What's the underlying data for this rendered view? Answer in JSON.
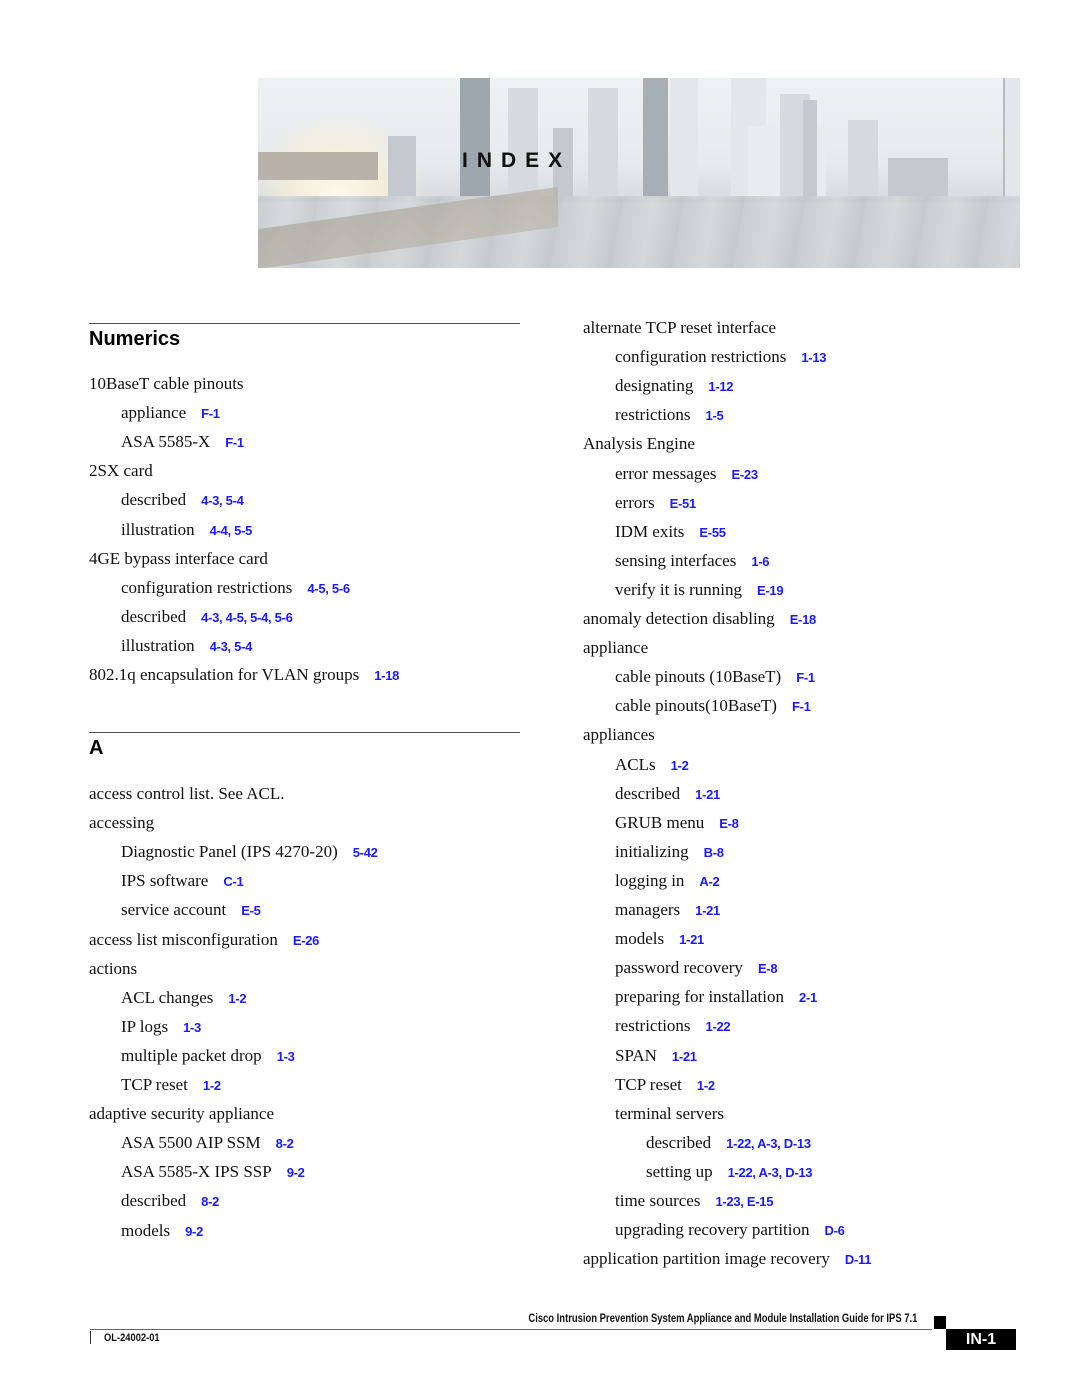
{
  "banner": {
    "title": "INDEX"
  },
  "columns": [
    {
      "sections": [
        {
          "heading": "Numerics",
          "entries": [
            {
              "level": 0,
              "text": "10BaseT cable pinouts",
              "refs": ""
            },
            {
              "level": 1,
              "text": "appliance",
              "refs": "F-1"
            },
            {
              "level": 1,
              "text": "ASA 5585-X",
              "refs": "F-1"
            },
            {
              "level": 0,
              "text": "2SX card",
              "refs": ""
            },
            {
              "level": 1,
              "text": "described",
              "refs": "4-3, 5-4"
            },
            {
              "level": 1,
              "text": "illustration",
              "refs": "4-4, 5-5"
            },
            {
              "level": 0,
              "text": "4GE bypass interface card",
              "refs": ""
            },
            {
              "level": 1,
              "text": "configuration restrictions",
              "refs": "4-5, 5-6"
            },
            {
              "level": 1,
              "text": "described",
              "refs": "4-3, 4-5, 5-4, 5-6"
            },
            {
              "level": 1,
              "text": "illustration",
              "refs": "4-3, 5-4"
            },
            {
              "level": 0,
              "text": "802.1q encapsulation for VLAN groups",
              "refs": "1-18"
            }
          ]
        },
        {
          "heading": "A",
          "entries": [
            {
              "level": 0,
              "text": "access control list. See ACL.",
              "refs": ""
            },
            {
              "level": 0,
              "text": "accessing",
              "refs": ""
            },
            {
              "level": 1,
              "text": "Diagnostic Panel (IPS 4270-20)",
              "refs": "5-42"
            },
            {
              "level": 1,
              "text": "IPS software",
              "refs": "C-1"
            },
            {
              "level": 1,
              "text": "service account",
              "refs": "E-5"
            },
            {
              "level": 0,
              "text": "access list misconfiguration",
              "refs": "E-26"
            },
            {
              "level": 0,
              "text": "actions",
              "refs": ""
            },
            {
              "level": 1,
              "text": "ACL changes",
              "refs": "1-2"
            },
            {
              "level": 1,
              "text": "IP logs",
              "refs": "1-3"
            },
            {
              "level": 1,
              "text": "multiple packet drop",
              "refs": "1-3"
            },
            {
              "level": 1,
              "text": "TCP reset",
              "refs": "1-2"
            },
            {
              "level": 0,
              "text": "adaptive security appliance",
              "refs": ""
            },
            {
              "level": 1,
              "text": "ASA 5500 AIP SSM",
              "refs": "8-2"
            },
            {
              "level": 1,
              "text": "ASA 5585-X IPS SSP",
              "refs": "9-2"
            },
            {
              "level": 1,
              "text": "described",
              "refs": "8-2"
            },
            {
              "level": 1,
              "text": "models",
              "refs": "9-2"
            }
          ]
        }
      ]
    },
    {
      "sections": [
        {
          "heading": "",
          "entries": [
            {
              "level": 0,
              "text": "alternate TCP reset interface",
              "refs": ""
            },
            {
              "level": 1,
              "text": "configuration restrictions",
              "refs": "1-13"
            },
            {
              "level": 1,
              "text": "designating",
              "refs": "1-12"
            },
            {
              "level": 1,
              "text": "restrictions",
              "refs": "1-5"
            },
            {
              "level": 0,
              "text": "Analysis Engine",
              "refs": ""
            },
            {
              "level": 1,
              "text": "error messages",
              "refs": "E-23"
            },
            {
              "level": 1,
              "text": "errors",
              "refs": "E-51"
            },
            {
              "level": 1,
              "text": "IDM exits",
              "refs": "E-55"
            },
            {
              "level": 1,
              "text": "sensing interfaces",
              "refs": "1-6"
            },
            {
              "level": 1,
              "text": "verify it is running",
              "refs": "E-19"
            },
            {
              "level": 0,
              "text": "anomaly detection disabling",
              "refs": "E-18"
            },
            {
              "level": 0,
              "text": "appliance",
              "refs": ""
            },
            {
              "level": 1,
              "text": "cable pinouts (10BaseT)",
              "refs": "F-1"
            },
            {
              "level": 1,
              "text": "cable pinouts(10BaseT)",
              "refs": "F-1"
            },
            {
              "level": 0,
              "text": "appliances",
              "refs": ""
            },
            {
              "level": 1,
              "text": "ACLs",
              "refs": "1-2"
            },
            {
              "level": 1,
              "text": "described",
              "refs": "1-21"
            },
            {
              "level": 1,
              "text": "GRUB menu",
              "refs": "E-8"
            },
            {
              "level": 1,
              "text": "initializing",
              "refs": "B-8"
            },
            {
              "level": 1,
              "text": "logging in",
              "refs": "A-2"
            },
            {
              "level": 1,
              "text": "managers",
              "refs": "1-21"
            },
            {
              "level": 1,
              "text": "models",
              "refs": "1-21"
            },
            {
              "level": 1,
              "text": "password recovery",
              "refs": "E-8"
            },
            {
              "level": 1,
              "text": "preparing for installation",
              "refs": "2-1"
            },
            {
              "level": 1,
              "text": "restrictions",
              "refs": "1-22"
            },
            {
              "level": 1,
              "text": "SPAN",
              "refs": "1-21"
            },
            {
              "level": 1,
              "text": "TCP reset",
              "refs": "1-2"
            },
            {
              "level": 1,
              "text": "terminal servers",
              "refs": ""
            },
            {
              "level": 2,
              "text": "described",
              "refs": "1-22, A-3, D-13"
            },
            {
              "level": 2,
              "text": "setting up",
              "refs": "1-22, A-3, D-13"
            },
            {
              "level": 1,
              "text": "time sources",
              "refs": "1-23, E-15"
            },
            {
              "level": 1,
              "text": "upgrading recovery partition",
              "refs": "D-6"
            },
            {
              "level": 0,
              "text": "application partition image recovery",
              "refs": "D-11"
            }
          ]
        }
      ]
    }
  ],
  "footer": {
    "guide_title": "Cisco Intrusion Prevention System Appliance and Module Installation Guide for IPS 7.1",
    "doc_number": "OL-24002-01",
    "page_number": "IN-1"
  },
  "colors": {
    "link": "#1a1aff",
    "text": "#111111"
  }
}
